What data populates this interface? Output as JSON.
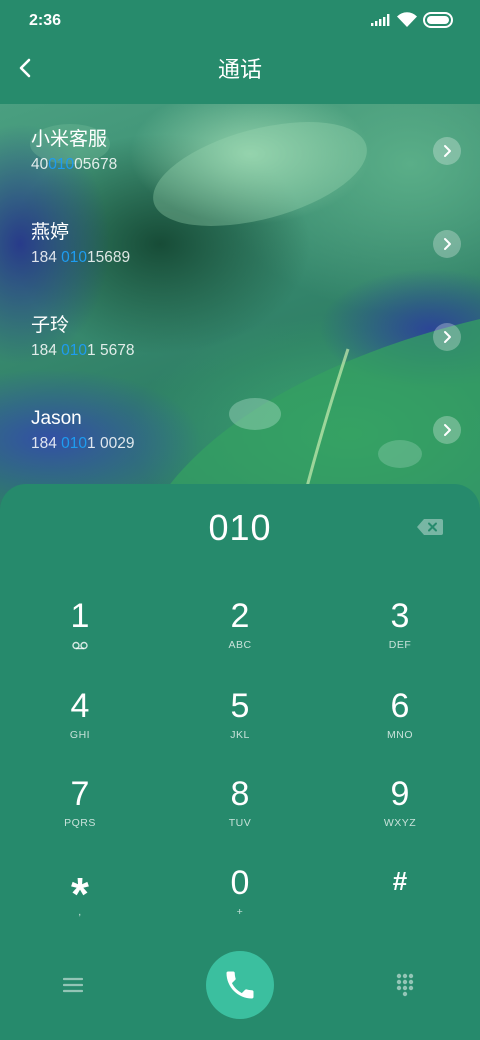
{
  "status_bar": {
    "time": "2:36",
    "icons": [
      "signal-icon",
      "wifi-icon",
      "battery-icon"
    ]
  },
  "header": {
    "title": "通话",
    "back_icon": "chevron-left-icon"
  },
  "results": [
    {
      "name": "小米客服",
      "number": {
        "before": "40",
        "match": "010",
        "after": "05678"
      }
    },
    {
      "name": "燕婷",
      "number": {
        "before": "184 ",
        "match": "010",
        "after": "15689"
      }
    },
    {
      "name": "子玲",
      "number": {
        "before": "184 ",
        "match": "010",
        "after": "1 5678"
      }
    },
    {
      "name": "Jason",
      "number": {
        "before": "184 ",
        "match": "010",
        "after": "1 0029"
      }
    }
  ],
  "result_action_icon": "chevron-right-icon",
  "dialer": {
    "input": "010",
    "backspace_icon": "backspace-icon",
    "keys": [
      {
        "digit": "1",
        "icon": "voicemail-icon"
      },
      {
        "digit": "2",
        "letters": "ABC"
      },
      {
        "digit": "3",
        "letters": "DEF"
      },
      {
        "digit": "4",
        "letters": "GHI"
      },
      {
        "digit": "5",
        "letters": "JKL"
      },
      {
        "digit": "6",
        "letters": "MNO"
      },
      {
        "digit": "7",
        "letters": "PQRS"
      },
      {
        "digit": "8",
        "letters": "TUV"
      },
      {
        "digit": "9",
        "letters": "WXYZ"
      },
      {
        "digit": "*",
        "letters": ","
      },
      {
        "digit": "0",
        "letters": "+"
      },
      {
        "digit": "#"
      }
    ]
  },
  "bottom_bar": {
    "left_icon": "menu-icon",
    "center_icon": "phone-icon",
    "right_icon": "dialpad-icon"
  },
  "colors": {
    "background": "#278b6c",
    "panel": "#268a6c",
    "highlight": "#1e9cf0",
    "call_button": "#3bbf9f"
  }
}
